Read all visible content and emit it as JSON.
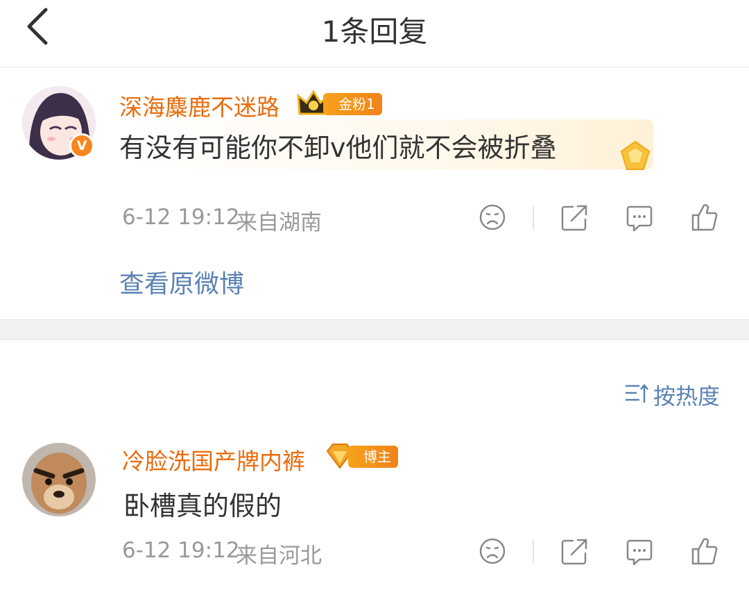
{
  "header": {
    "title": "1条回复",
    "back_icon": "chevron-left-icon"
  },
  "main_comment": {
    "username": "深海麋鹿不迷路",
    "badge_label": "金粉1",
    "text": "有没有可能你不卸v他们就不会被折叠",
    "timestamp": "6-12 19:12",
    "location": "来自湖南",
    "view_original": "查看原微博"
  },
  "sort": {
    "label": "按热度"
  },
  "reply": {
    "username": "冷脸洗国产牌内裤",
    "badge_label": "博主",
    "text": "卧槽真的假的",
    "timestamp": "6-12 19:12",
    "location": "来自河北"
  },
  "colors": {
    "username": "#eb6b0b",
    "link": "#5b82b3",
    "meta": "#999999",
    "badge": "#f08317"
  }
}
